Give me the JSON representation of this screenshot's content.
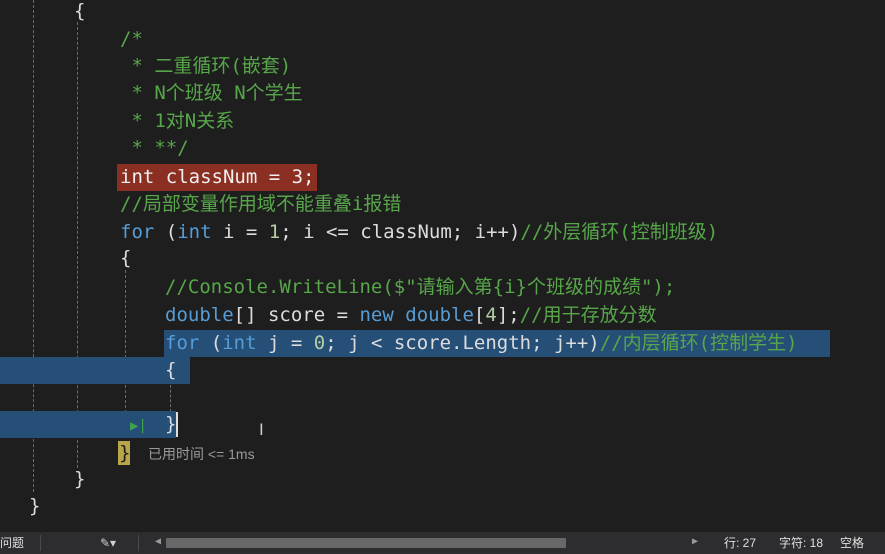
{
  "code": {
    "lines": {
      "l0": "{",
      "l1": "/*",
      "l2": " * 二重循环(嵌套)",
      "l3": " * N个班级 N个学生",
      "l4": " * 1对N关系",
      "l5": " * **/",
      "l6_int": "int",
      "l6_rest": " classNum = 3;",
      "l7": "//局部变量作用域不能重叠i报错",
      "l8_for": "for",
      "l8_open": " (",
      "l8_int": "int",
      "l8_mid": " i = ",
      "l8_one": "1",
      "l8_rest": "; i <= classNum; i++)",
      "l8_comment": "//外层循环(控制班级)",
      "l9": "{",
      "l10": "//Console.WriteLine($\"请输入第{i}个班级的成绩\");",
      "l11_double": "double",
      "l11_a": "[] score = ",
      "l11_new": "new",
      "l11_sp": " ",
      "l11_double2": "double",
      "l11_b": "[",
      "l11_four": "4",
      "l11_c": "];",
      "l11_comment": "//用于存放分数",
      "l12_for": "for",
      "l12_open": " (",
      "l12_int": "int",
      "l12_mid": " j = ",
      "l12_zero": "0",
      "l12_rest": "; j < score.Length; j++)",
      "l12_comment": "//内层循环(控制学生)",
      "l13": "{",
      "l15": "}",
      "l16": "}",
      "l17": "}",
      "l18": "}"
    },
    "elapsed_hint": "已用时间 <= 1ms"
  },
  "status_bar": {
    "left_label": "问题",
    "line": "行: 27",
    "char": "字符: 18",
    "mode": "空格"
  },
  "colors": {
    "background": "#1e1e1e",
    "keyword": "#569cd6",
    "comment": "#57a64a",
    "error_highlight": "#8a2f22",
    "selection": "#264f78"
  }
}
